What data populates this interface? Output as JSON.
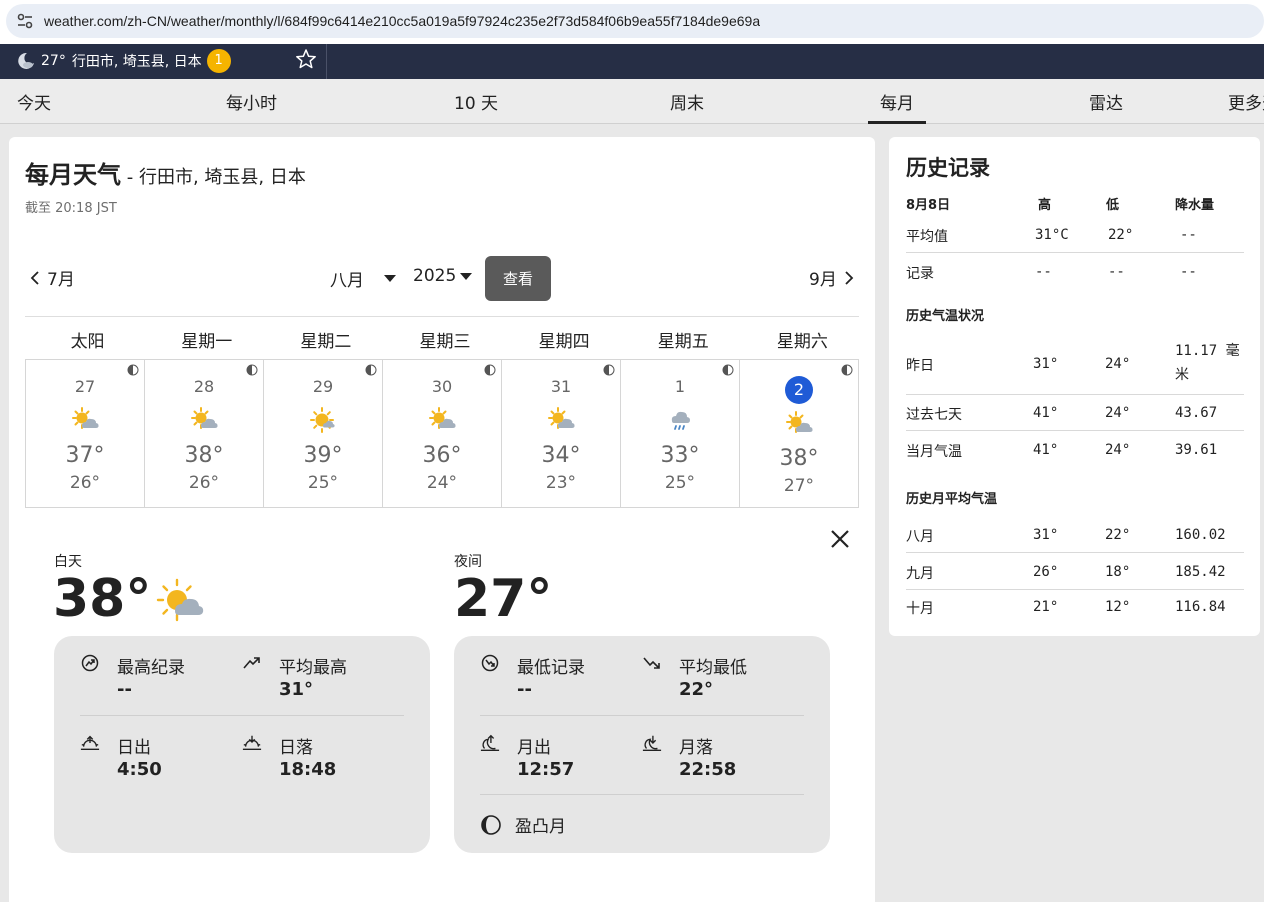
{
  "browser": {
    "url_domain": "weather.com",
    "url_path": "/zh-CN/weather/monthly/l/684f99c6414e210cc5a019a5f97924c235e2f73d584f06b9ea55f7184de9e69a"
  },
  "header": {
    "location_temp": "27°",
    "location_name": "行田市, 埼玉县, 日本",
    "alert_count": "1"
  },
  "nav": {
    "tabs": [
      "今天",
      "每小时",
      "10 天",
      "周末",
      "每月",
      "雷达",
      "更多天"
    ],
    "active_index": 4
  },
  "monthly": {
    "title": "每月天气",
    "subtitle": " - 行田市, 埼玉县, 日本",
    "as_of": "截至 20:18 JST",
    "prev_month": "7月",
    "next_month": "9月",
    "selected_month": "八月",
    "selected_year": "2025",
    "view_button": "查看",
    "weekdays": [
      "太阳",
      "星期一",
      "星期二",
      "星期三",
      "星期四",
      "星期五",
      "星期六"
    ],
    "days": [
      {
        "date": "27",
        "icon": "partly-cloudy-day-icon",
        "high": "37°",
        "low": "26°"
      },
      {
        "date": "28",
        "icon": "partly-cloudy-day-icon",
        "high": "38°",
        "low": "26°"
      },
      {
        "date": "29",
        "icon": "mostly-sunny-icon",
        "high": "39°",
        "low": "25°"
      },
      {
        "date": "30",
        "icon": "partly-cloudy-day-icon",
        "high": "36°",
        "low": "24°"
      },
      {
        "date": "31",
        "icon": "partly-cloudy-day-icon",
        "high": "34°",
        "low": "23°"
      },
      {
        "date": "1",
        "icon": "rain-icon",
        "high": "33°",
        "low": "25°"
      },
      {
        "date": "2",
        "icon": "partly-cloudy-day-icon",
        "high": "38°",
        "low": "27°",
        "selected": true
      }
    ]
  },
  "detail": {
    "day_label": "白天",
    "day_temp": "38°",
    "night_label": "夜间",
    "night_temp": "27°",
    "day_stats": {
      "record_high_label": "最高纪录",
      "record_high_value": "--",
      "avg_high_label": "平均最高",
      "avg_high_value": "31°",
      "sunrise_label": "日出",
      "sunrise_value": "4:50",
      "sunset_label": "日落",
      "sunset_value": "18:48"
    },
    "night_stats": {
      "record_low_label": "最低记录",
      "record_low_value": "--",
      "avg_low_label": "平均最低",
      "avg_low_value": "22°",
      "moonrise_label": "月出",
      "moonrise_value": "12:57",
      "moonset_label": "月落",
      "moonset_value": "22:58",
      "moon_phase": "盈凸月"
    }
  },
  "history": {
    "title": "历史记录",
    "date": "8月8日",
    "col_high": "高",
    "col_low": "低",
    "col_precip": "降水量",
    "avg_label": "平均值",
    "avg_high": "31°C",
    "avg_low": "22°",
    "avg_precip": "--",
    "record_label": "记录",
    "record_high": "--",
    "record_low": "--",
    "record_precip": "--",
    "temp_section": "历史气温状况",
    "temp_rows": [
      {
        "label": "昨日",
        "high": "31°",
        "low": "24°",
        "precip": "11.17 毫米"
      },
      {
        "label": "过去七天",
        "high": "41°",
        "low": "24°",
        "precip": "43.67"
      },
      {
        "label": "当月气温",
        "high": "41°",
        "low": "24°",
        "precip": "39.61"
      }
    ],
    "monthly_section": "历史月平均气温",
    "month_rows": [
      {
        "label": "八月",
        "high": "31°",
        "low": "22°",
        "precip": "160.02"
      },
      {
        "label": "九月",
        "high": "26°",
        "low": "18°",
        "precip": "185.42"
      },
      {
        "label": "十月",
        "high": "21°",
        "low": "12°",
        "precip": "116.84"
      }
    ]
  },
  "colors": {
    "header_bg": "#262e45",
    "badge": "#f5b400",
    "sun": "#f3b61f",
    "cloud": "#a4b0bd",
    "selected_day": "#1f5bd6",
    "view_button": "#5a5a5a",
    "panel": "#e6e6e6"
  }
}
